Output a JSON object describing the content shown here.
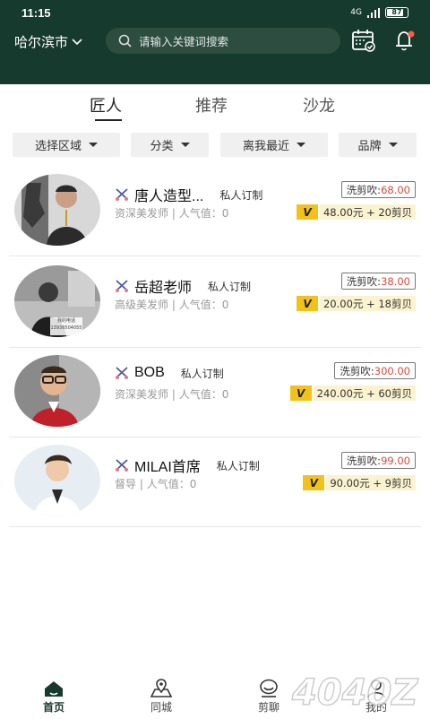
{
  "status_bar": {
    "time": "11:15",
    "network": "4G",
    "battery": "87",
    "battery_level": 0.87
  },
  "header": {
    "city": "哈尔滨市",
    "search_placeholder": "请输入关键词搜索",
    "icons": [
      "calendar-check-icon",
      "bell-icon"
    ],
    "notification_dot_color": "#ff5a3c"
  },
  "tabs": [
    {
      "label": "匠人",
      "active": true
    },
    {
      "label": "推荐",
      "active": false
    },
    {
      "label": "沙龙",
      "active": false
    }
  ],
  "filters": [
    {
      "label": "选择区域"
    },
    {
      "label": "分类"
    },
    {
      "label": "离我最近"
    },
    {
      "label": "品牌"
    }
  ],
  "stylists": [
    {
      "name": "唐人造型...",
      "tag": "私人订制",
      "title": "资深美发师",
      "popularity_label": "人气值：0",
      "service_label": "洗剪吹:",
      "service_price": "68.00",
      "vip_text": "48.00元 + 20剪贝"
    },
    {
      "name": "岳超老师",
      "tag": "私人订制",
      "title": "高级美发师",
      "popularity_label": "人气值：0",
      "service_label": "洗剪吹:",
      "service_price": "38.00",
      "vip_text": "20.00元 + 18剪贝",
      "avatar_caption": "我的电话 13936504055"
    },
    {
      "name": "BOB",
      "tag": "私人订制",
      "title": "资深美发师",
      "popularity_label": "人气值：0",
      "service_label": "洗剪吹:",
      "service_price": "300.00",
      "vip_text": "240.00元 + 60剪贝"
    },
    {
      "name": "MILAI首席",
      "tag": "私人订制",
      "title": "督导",
      "popularity_label": "人气值：0",
      "service_label": "洗剪吹:",
      "service_price": "99.00",
      "vip_text": "90.00元 + 9剪贝"
    }
  ],
  "vip_badge": "V",
  "bottom_nav": [
    {
      "label": "首页",
      "icon": "home-icon",
      "active": true
    },
    {
      "label": "同城",
      "icon": "map-location-icon",
      "active": false
    },
    {
      "label": "剪聊",
      "icon": "chat-bubble-icon",
      "active": false
    },
    {
      "label": "我的",
      "icon": "person-icon",
      "active": false
    }
  ],
  "watermark": "4040Z",
  "colors": {
    "header_bg": "#173a2e",
    "price_red": "#d94a3a",
    "vip_yellow": "#f2c21a"
  }
}
